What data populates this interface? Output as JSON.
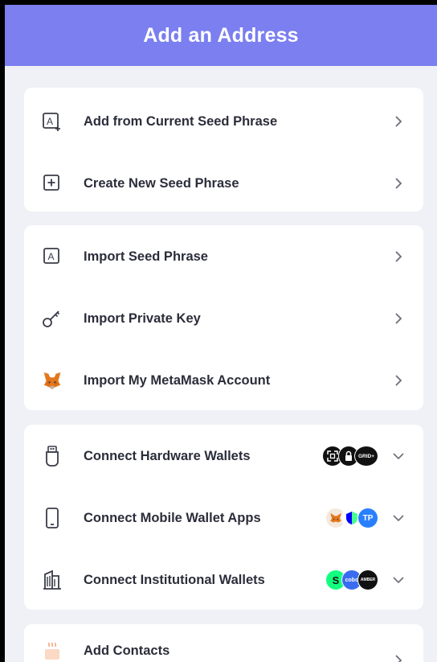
{
  "header": {
    "title": "Add an Address"
  },
  "groups": [
    {
      "items": [
        {
          "label": "Add from Current Seed Phrase",
          "icon": "add-seed-icon"
        },
        {
          "label": "Create New Seed Phrase",
          "icon": "plus-box-icon"
        }
      ]
    },
    {
      "items": [
        {
          "label": "Import Seed Phrase",
          "icon": "letter-a-icon"
        },
        {
          "label": "Import Private Key",
          "icon": "key-icon"
        },
        {
          "label": "Import My MetaMask Account",
          "icon": "metamask-fox-icon"
        }
      ]
    },
    {
      "items": [
        {
          "label": "Connect Hardware Wallets",
          "icon": "usb-device-icon",
          "badges": [
            "ledger-icon",
            "keystone-icon",
            "GRID+"
          ]
        },
        {
          "label": "Connect Mobile Wallet Apps",
          "icon": "phone-icon",
          "badges": [
            "metamask-fox-icon",
            "trust-shield-icon",
            "TP"
          ]
        },
        {
          "label": "Connect Institutional Wallets",
          "icon": "building-icon",
          "badges": [
            "S",
            "cobo",
            "AMBER"
          ]
        }
      ]
    },
    {
      "items": [
        {
          "label": "Add Contacts",
          "icon": "coffee-cup-icon"
        }
      ]
    }
  ],
  "colors": {
    "header": "#7b7ff0",
    "background": "#f0f1f6",
    "card": "#ffffff",
    "text": "#2b2d3a",
    "icon": "#3a3c48"
  }
}
